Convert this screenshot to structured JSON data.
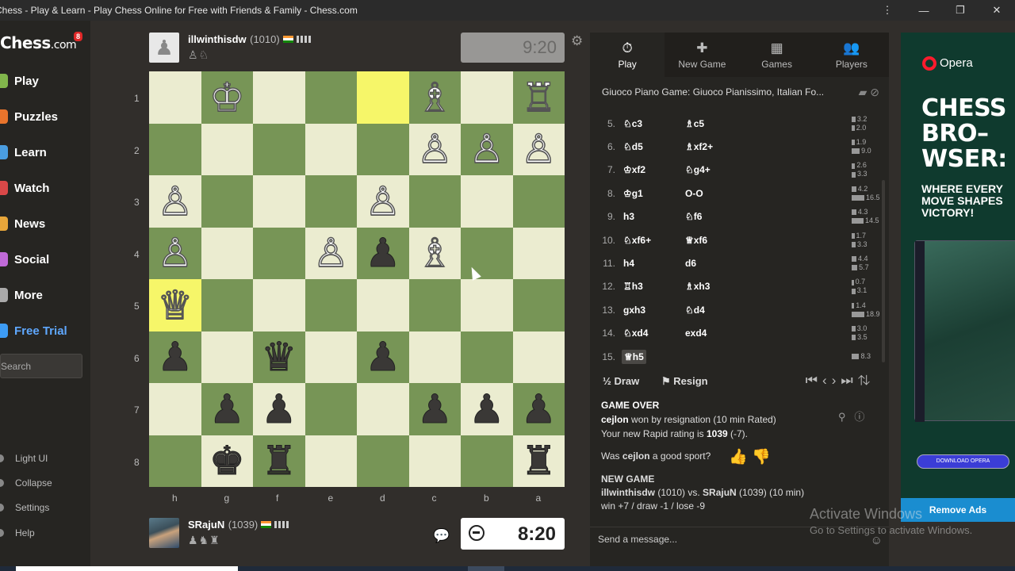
{
  "window": {
    "title": "Chess - Play & Learn - Play Chess Online for Free with Friends & Family - Chess.com",
    "buttons": [
      "⋮",
      "—",
      "❐",
      "✕"
    ]
  },
  "sidebar": {
    "logo": "Chess",
    "logo_suffix": ".com",
    "badge": "8",
    "items": [
      {
        "label": "Play",
        "color": "#81b64c"
      },
      {
        "label": "Puzzles",
        "color": "#e8742c"
      },
      {
        "label": "Learn",
        "color": "#4a9de0"
      },
      {
        "label": "Watch",
        "color": "#d94848"
      },
      {
        "label": "News",
        "color": "#e8a63a"
      },
      {
        "label": "Social",
        "color": "#c06ad8"
      },
      {
        "label": "More",
        "color": "#aaaaaa"
      },
      {
        "label": "Free Trial",
        "color": "#3d9cf5"
      }
    ],
    "search_placeholder": "Search",
    "bottom_items": [
      "Light UI",
      "Collapse",
      "Settings",
      "Help"
    ]
  },
  "top_player": {
    "name": "illwinthisdw",
    "rating": "(1010)",
    "captured": "♙♘",
    "clock": "9:20"
  },
  "bottom_player": {
    "name": "SRajuN",
    "rating": "(1039)",
    "captured": "♟♞♜",
    "clock": "8:20"
  },
  "board": {
    "ranks": [
      "1",
      "2",
      "3",
      "4",
      "5",
      "6",
      "7",
      "8"
    ],
    "files": [
      "h",
      "g",
      "f",
      "e",
      "d",
      "c",
      "b",
      "a"
    ],
    "pieces": [
      [
        "",
        "wK",
        "",
        "",
        "",
        "wB",
        "",
        "wR"
      ],
      [
        "",
        "",
        "",
        "",
        "",
        "wP",
        "wP",
        "wP"
      ],
      [
        "wP",
        "",
        "",
        "",
        "wP",
        "",
        "",
        ""
      ],
      [
        "wP",
        "",
        "",
        "wP",
        "bP",
        "wB",
        "",
        ""
      ],
      [
        "wQ",
        "",
        "",
        "",
        "",
        "",
        "",
        ""
      ],
      [
        "bP",
        "",
        "bQ",
        "",
        "bP",
        "",
        "",
        ""
      ],
      [
        "",
        "bP",
        "bP",
        "",
        "",
        "bP",
        "bP",
        "bP"
      ],
      [
        "",
        "bK",
        "bR",
        "",
        "",
        "",
        "",
        "bR"
      ]
    ],
    "highlights": [
      [
        0,
        4
      ],
      [
        4,
        0
      ]
    ]
  },
  "panel": {
    "tabs": [
      {
        "label": "Play",
        "icon": "⏱"
      },
      {
        "label": "New Game",
        "icon": "✚"
      },
      {
        "label": "Games",
        "icon": "▦"
      },
      {
        "label": "Players",
        "icon": "👥"
      }
    ],
    "opening": "Giuoco Piano Game: Giuoco Pianissimo, Italian Fo...",
    "moves": [
      {
        "num": "5.",
        "white": "♘c3",
        "black": "♗c5",
        "t1": "3.2",
        "t2": "2.0"
      },
      {
        "num": "6.",
        "white": "♘d5",
        "black": "♗xf2+",
        "t1": "1.9",
        "t2": "9.0"
      },
      {
        "num": "7.",
        "white": "♔xf2",
        "black": "♘g4+",
        "t1": "2.6",
        "t2": "3.3"
      },
      {
        "num": "8.",
        "white": "♔g1",
        "black": "O-O",
        "t1": "4.2",
        "t2": "16.5"
      },
      {
        "num": "9.",
        "white": "h3",
        "black": "♘f6",
        "t1": "4.3",
        "t2": "14.5"
      },
      {
        "num": "10.",
        "white": "♘xf6+",
        "black": "♕xf6",
        "t1": "1.7",
        "t2": "3.3"
      },
      {
        "num": "11.",
        "white": "h4",
        "black": "d6",
        "t1": "4.4",
        "t2": "5.7"
      },
      {
        "num": "12.",
        "white": "♖h3",
        "black": "♗xh3",
        "t1": "0.7",
        "t2": "3.1"
      },
      {
        "num": "13.",
        "white": "gxh3",
        "black": "♘d4",
        "t1": "1.4",
        "t2": "18.9"
      },
      {
        "num": "14.",
        "white": "♘xd4",
        "black": "exd4",
        "t1": "3.0",
        "t2": "3.5"
      },
      {
        "num": "15.",
        "white": "♕h5",
        "black": "",
        "t1": "8.3",
        "t2": ""
      }
    ],
    "draw_label": "Draw",
    "resign_label": "Resign",
    "result_title": "GAME OVER",
    "result_winner": "cejlon",
    "result_text": " won by resignation (10 min Rated)",
    "rating_text": "Your new Rapid rating is ",
    "rating_value": "1039",
    "rating_delta": " (-7).",
    "sport_prefix": "Was ",
    "sport_name": "cejlon",
    "sport_suffix": " a good sport?",
    "newgame_title": "NEW GAME",
    "newgame_p1": "illwinthisdw",
    "newgame_r1": " (1010) vs. ",
    "newgame_p2": "SRajuN",
    "newgame_r2": " (1039) (10 min)",
    "newgame_stats": "win +7 / draw -1 / lose -9",
    "message_placeholder": "Send a message..."
  },
  "ad": {
    "brand": "Opera",
    "title": "CHESS BRO– WSER:",
    "subtitle": "WHERE EVERY MOVE SHAPES VICTORY!",
    "button": "DOWNLOAD OPERA",
    "remove": "Remove Ads"
  },
  "watermark": {
    "line1": "Activate Windows",
    "line2": "Go to Settings to activate Windows."
  }
}
